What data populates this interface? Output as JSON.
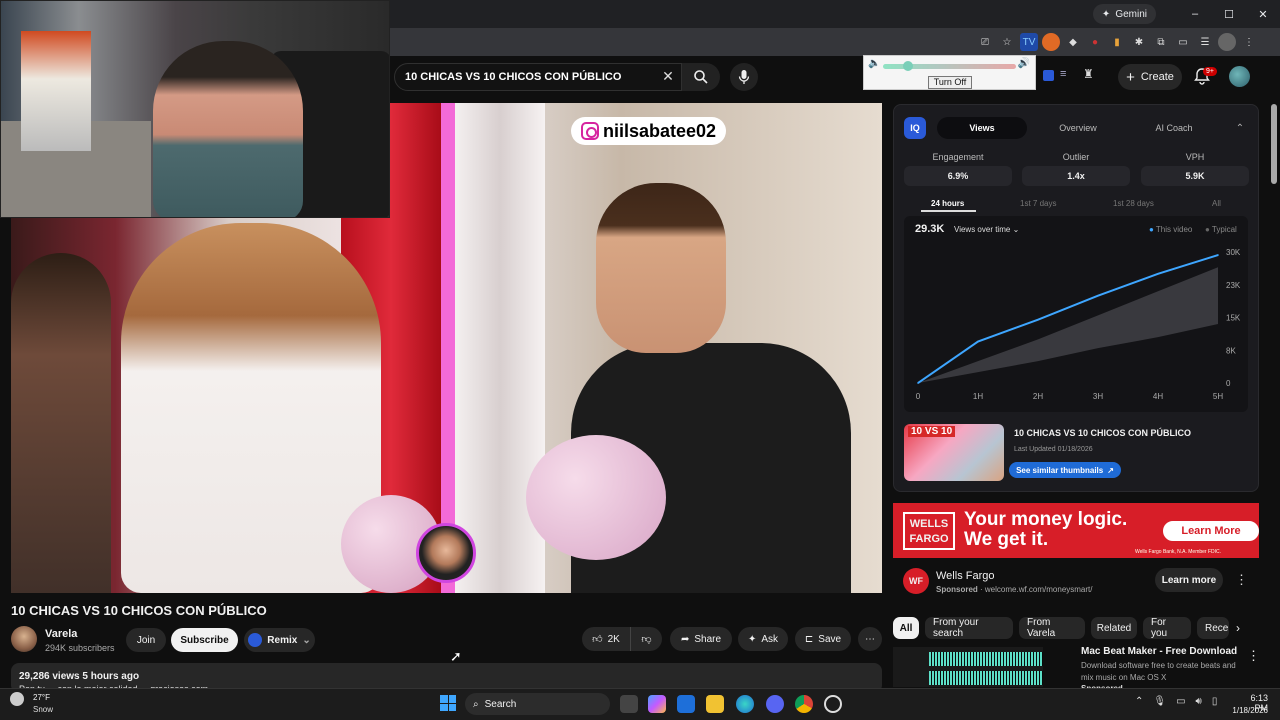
{
  "browser": {
    "gemini_label": "Gemini",
    "window_controls": {
      "minimize": "–",
      "maximize": "☐",
      "close": "✕"
    }
  },
  "search": {
    "value": "10 CHICAS VS 10 CHICOS CON PÚBLICO"
  },
  "volume_popup": {
    "turn_off_label": "Turn Off",
    "level": 0.2
  },
  "header": {
    "create_label": "Create",
    "notifications_badge": "9+"
  },
  "video": {
    "instagram_handle": "niilsabatee02",
    "title": "10 CHICAS VS 10 CHICOS CON PÚBLICO",
    "channel_name": "Varela",
    "subscribers": "294K subscribers",
    "join_label": "Join",
    "subscribe_label": "Subscribe",
    "remix_label": "Remix",
    "likes": "2K",
    "share_label": "Share",
    "ask_label": "Ask",
    "save_label": "Save",
    "views_line": "29,286 views  5 hours ago",
    "description_snippet": "Pon tu ... con la mejor calidad ... graciosos.com"
  },
  "vidiq": {
    "tabs": [
      "Views",
      "Overview",
      "AI Coach"
    ],
    "metrics": [
      {
        "label": "Engagement",
        "value": "6.9%"
      },
      {
        "label": "Outlier",
        "value": "1.4x"
      },
      {
        "label": "VPH",
        "value": "5.9K"
      }
    ],
    "ranges": [
      "24 hours",
      "1st 7 days",
      "1st 28 days",
      "All"
    ],
    "total_views": "29.3K",
    "mode_label": "Views over time",
    "legend_this": "This video",
    "legend_typical": "Typical",
    "thumb_title": "10 CHICAS VS 10 CHICOS CON PÚBLICO",
    "thumb_updated": "Last Updated 01/18/2026",
    "similar_label": "See similar thumbnails",
    "thumb_text": "10 VS 10"
  },
  "chart_data": {
    "type": "line",
    "x": [
      "0",
      "1H",
      "2H",
      "3H",
      "4H",
      "5H"
    ],
    "yticks": [
      "0",
      "8K",
      "15K",
      "23K",
      "30K"
    ],
    "ylim": [
      0,
      30000
    ],
    "series": [
      {
        "name": "This video",
        "values": [
          0,
          9500,
          14500,
          20000,
          25000,
          29300
        ]
      }
    ],
    "typical_band": {
      "low": [
        0,
        2500,
        5000,
        8000,
        10500,
        13500
      ],
      "high": [
        0,
        5000,
        10000,
        15500,
        21000,
        26500
      ]
    },
    "colors": {
      "this_video": "#3ea6ff",
      "typical": "#4a4a50"
    }
  },
  "ad": {
    "headline_line1": "Your money logic.",
    "headline_line2": "We get it.",
    "logo_top": "WELLS",
    "logo_bottom": "FARGO",
    "banner_cta": "Learn More",
    "fine_print": "Wells Fargo Bank, N.A. Member FDIC.",
    "advertiser": "Wells Fargo",
    "sponsored": "Sponsored",
    "url": "welcome.wf.com/moneysmart/",
    "cta": "Learn more",
    "avatar_text": "WF"
  },
  "chips": [
    "All",
    "From your search",
    "From Varela",
    "Related",
    "For you",
    "Rece"
  ],
  "recommendation": {
    "title": "Mac Beat Maker - Free Download",
    "description": "Download software free to create beats and mix music on Mac OS X",
    "sponsored": "Sponsored"
  },
  "taskbar": {
    "temp": "27°F",
    "condition": "Snow",
    "search_label": "Search",
    "time": "6:13 PM",
    "date": "1/18/2026"
  }
}
